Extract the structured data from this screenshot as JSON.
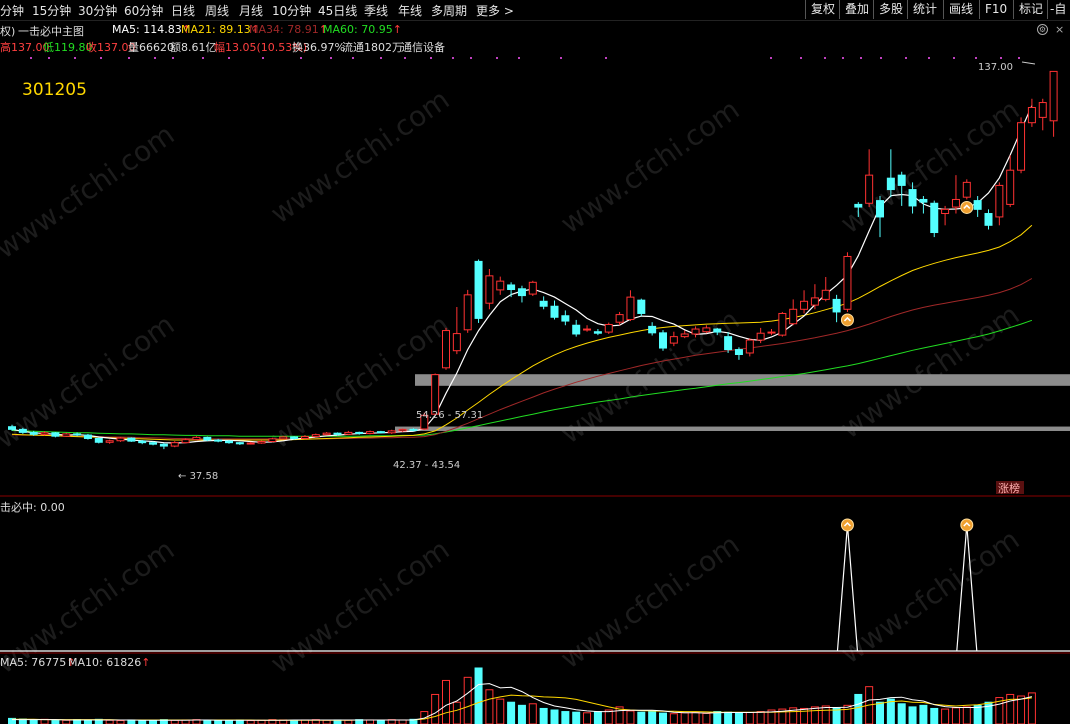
{
  "toolbar": {
    "periods": [
      "分钟",
      "15分钟",
      "30分钟",
      "60分钟",
      "日线",
      "周线",
      "月线",
      "10分钟",
      "45日线",
      "季线",
      "年线",
      "多周期",
      "更多 >"
    ],
    "buttons": [
      "复权",
      "叠加",
      "多股",
      "统计",
      "画线",
      "F10",
      "标记",
      "-自"
    ]
  },
  "header": {
    "left_tag": "权)",
    "indicator_name": "一击必中主图",
    "ma5": "MA5: 114.83",
    "ma21": "MA21: 89.13",
    "ma34": "MA34: 78.91",
    "ma60": "MA60: 70.95",
    "ma_colors": {
      "ma5": "#ffffff",
      "ma21": "#ffd800",
      "ma34": "#b03030",
      "ma60": "#22dd22"
    }
  },
  "quote": {
    "high": "高137.00",
    "low": "低119.80",
    "close": "收137.00",
    "volume": "量66620",
    "amount": "额8.61亿",
    "change": "幅13.05(10.53%)",
    "turnover": "换36.97%",
    "float": "流通1802万",
    "industry": "通信设备"
  },
  "stock_code": "301205",
  "annotations": {
    "max_price": "137.00",
    "min_price": "37.58",
    "band_upper": "54.26 - 57.31",
    "band_lower": "42.37 - 43.54",
    "limit_tag": "涨榜"
  },
  "signal_panel": {
    "title": "击必中: 0.00"
  },
  "volume_panel": {
    "ma5": "MA5: 76775",
    "ma10": "MA10: 61826"
  },
  "watermark": "www.cfchi.com",
  "colors": {
    "up": "#ff3232",
    "down": "#54ffff",
    "ma5": "#ffffff",
    "ma21": "#ffd800",
    "ma34": "#a02828",
    "ma60": "#22dd22",
    "band": "#8c8c8c",
    "signal": "#ffffff"
  },
  "chart_data": {
    "type": "candlestick",
    "ylim": [
      30,
      140
    ],
    "candles": [
      {
        "o": 43.5,
        "c": 42.8,
        "h": 44.0,
        "l": 42.4
      },
      {
        "o": 42.8,
        "c": 42.0,
        "h": 43.2,
        "l": 41.6
      },
      {
        "o": 42.0,
        "c": 41.5,
        "h": 42.4,
        "l": 41.1
      },
      {
        "o": 41.5,
        "c": 41.9,
        "h": 42.3,
        "l": 41.2
      },
      {
        "o": 41.9,
        "c": 41.0,
        "h": 42.1,
        "l": 40.7
      },
      {
        "o": 41.0,
        "c": 41.6,
        "h": 41.9,
        "l": 40.8
      },
      {
        "o": 41.6,
        "c": 41.3,
        "h": 42.0,
        "l": 41.0
      },
      {
        "o": 41.3,
        "c": 40.4,
        "h": 41.6,
        "l": 40.1
      },
      {
        "o": 40.4,
        "c": 39.4,
        "h": 40.6,
        "l": 39.1
      },
      {
        "o": 39.4,
        "c": 39.8,
        "h": 40.1,
        "l": 39.0
      },
      {
        "o": 39.8,
        "c": 40.5,
        "h": 40.8,
        "l": 39.5
      },
      {
        "o": 40.5,
        "c": 39.7,
        "h": 40.7,
        "l": 39.5
      },
      {
        "o": 39.7,
        "c": 39.3,
        "h": 40.0,
        "l": 38.9
      },
      {
        "o": 39.3,
        "c": 38.9,
        "h": 39.6,
        "l": 38.6
      },
      {
        "o": 38.9,
        "c": 38.4,
        "h": 39.2,
        "l": 37.6
      },
      {
        "o": 38.4,
        "c": 39.3,
        "h": 39.7,
        "l": 38.1
      },
      {
        "o": 39.3,
        "c": 40.1,
        "h": 40.4,
        "l": 39.1
      },
      {
        "o": 40.1,
        "c": 40.7,
        "h": 41.0,
        "l": 39.9
      },
      {
        "o": 40.7,
        "c": 40.0,
        "h": 40.9,
        "l": 39.7
      },
      {
        "o": 40.0,
        "c": 39.7,
        "h": 40.3,
        "l": 39.4
      },
      {
        "o": 39.7,
        "c": 39.3,
        "h": 40.0,
        "l": 39.0
      },
      {
        "o": 39.3,
        "c": 39.0,
        "h": 39.5,
        "l": 38.7
      },
      {
        "o": 39.0,
        "c": 39.2,
        "h": 39.5,
        "l": 38.8
      },
      {
        "o": 39.2,
        "c": 39.6,
        "h": 39.8,
        "l": 39.0
      },
      {
        "o": 39.6,
        "c": 40.3,
        "h": 40.6,
        "l": 39.4
      },
      {
        "o": 40.3,
        "c": 40.8,
        "h": 41.1,
        "l": 40.1
      },
      {
        "o": 40.8,
        "c": 40.4,
        "h": 41.0,
        "l": 40.1
      },
      {
        "o": 40.4,
        "c": 40.9,
        "h": 41.3,
        "l": 40.2
      },
      {
        "o": 40.9,
        "c": 41.4,
        "h": 41.7,
        "l": 40.7
      },
      {
        "o": 41.4,
        "c": 41.8,
        "h": 42.1,
        "l": 41.2
      },
      {
        "o": 41.8,
        "c": 41.5,
        "h": 42.0,
        "l": 41.2
      },
      {
        "o": 41.5,
        "c": 42.0,
        "h": 42.4,
        "l": 41.3
      },
      {
        "o": 42.0,
        "c": 41.7,
        "h": 42.2,
        "l": 41.4
      },
      {
        "o": 41.7,
        "c": 42.2,
        "h": 42.5,
        "l": 41.5
      },
      {
        "o": 42.2,
        "c": 41.9,
        "h": 42.4,
        "l": 41.7
      },
      {
        "o": 41.9,
        "c": 42.4,
        "h": 42.7,
        "l": 41.6
      },
      {
        "o": 42.4,
        "c": 42.8,
        "h": 43.0,
        "l": 42.1
      },
      {
        "o": 42.8,
        "c": 42.6,
        "h": 43.1,
        "l": 42.3
      },
      {
        "o": 42.9,
        "c": 46.5,
        "h": 47.2,
        "l": 42.6
      },
      {
        "o": 46.8,
        "c": 57.2,
        "h": 57.5,
        "l": 46.6
      },
      {
        "o": 59.0,
        "c": 68.8,
        "h": 69.5,
        "l": 58.5
      },
      {
        "o": 63.5,
        "c": 68.0,
        "h": 75.0,
        "l": 62.6
      },
      {
        "o": 69.0,
        "c": 78.2,
        "h": 79.5,
        "l": 68.2
      },
      {
        "o": 87.0,
        "c": 72.0,
        "h": 87.5,
        "l": 70.8
      },
      {
        "o": 76.0,
        "c": 83.2,
        "h": 85.0,
        "l": 74.4
      },
      {
        "o": 79.5,
        "c": 81.8,
        "h": 83.0,
        "l": 78.2
      },
      {
        "o": 80.8,
        "c": 79.6,
        "h": 81.5,
        "l": 77.6
      },
      {
        "o": 79.8,
        "c": 78.0,
        "h": 80.6,
        "l": 76.2
      },
      {
        "o": 78.4,
        "c": 81.5,
        "h": 81.9,
        "l": 77.9
      },
      {
        "o": 76.5,
        "c": 75.2,
        "h": 77.8,
        "l": 74.4
      },
      {
        "o": 75.2,
        "c": 72.3,
        "h": 76.7,
        "l": 71.7
      },
      {
        "o": 72.7,
        "c": 71.3,
        "h": 74.1,
        "l": 70.2
      },
      {
        "o": 70.2,
        "c": 67.9,
        "h": 71.6,
        "l": 67.2
      },
      {
        "o": 69.2,
        "c": 69.2,
        "h": 70.2,
        "l": 68.5
      },
      {
        "o": 68.5,
        "c": 68.1,
        "h": 69.2,
        "l": 67.6
      },
      {
        "o": 68.4,
        "c": 70.4,
        "h": 70.9,
        "l": 67.9
      },
      {
        "o": 71.0,
        "c": 73.0,
        "h": 73.7,
        "l": 70.2
      },
      {
        "o": 71.7,
        "c": 77.6,
        "h": 79.4,
        "l": 71.3
      },
      {
        "o": 76.8,
        "c": 73.3,
        "h": 77.2,
        "l": 72.6
      },
      {
        "o": 69.9,
        "c": 68.2,
        "h": 71.0,
        "l": 67.5
      },
      {
        "o": 68.2,
        "c": 64.2,
        "h": 68.9,
        "l": 63.5
      },
      {
        "o": 65.5,
        "c": 67.2,
        "h": 68.5,
        "l": 64.7
      },
      {
        "o": 67.2,
        "c": 67.9,
        "h": 68.8,
        "l": 66.8
      },
      {
        "o": 67.9,
        "c": 69.2,
        "h": 69.9,
        "l": 67.0
      },
      {
        "o": 68.5,
        "c": 69.5,
        "h": 70.2,
        "l": 68.1
      },
      {
        "o": 69.2,
        "c": 68.4,
        "h": 69.5,
        "l": 67.6
      },
      {
        "o": 67.2,
        "c": 63.8,
        "h": 68.4,
        "l": 62.9
      },
      {
        "o": 63.8,
        "c": 62.5,
        "h": 64.4,
        "l": 61.1
      },
      {
        "o": 62.9,
        "c": 66.3,
        "h": 66.8,
        "l": 62.0
      },
      {
        "o": 66.3,
        "c": 68.1,
        "h": 69.5,
        "l": 65.5
      },
      {
        "o": 68.4,
        "c": 68.4,
        "h": 69.2,
        "l": 67.6
      },
      {
        "o": 67.6,
        "c": 73.3,
        "h": 73.7,
        "l": 67.2
      },
      {
        "o": 70.6,
        "c": 74.4,
        "h": 77.0,
        "l": 70.2
      },
      {
        "o": 74.4,
        "c": 76.5,
        "h": 79.4,
        "l": 73.3
      },
      {
        "o": 75.5,
        "c": 77.4,
        "h": 81.0,
        "l": 74.4
      },
      {
        "o": 77.0,
        "c": 79.4,
        "h": 82.9,
        "l": 76.5
      },
      {
        "o": 77.0,
        "c": 73.7,
        "h": 78.2,
        "l": 71.0
      },
      {
        "o": 74.4,
        "c": 88.3,
        "h": 89.4,
        "l": 73.7
      },
      {
        "o": 102.0,
        "c": 101.3,
        "h": 102.6,
        "l": 98.7
      },
      {
        "o": 102.3,
        "c": 109.7,
        "h": 116.5,
        "l": 101.3
      },
      {
        "o": 103.0,
        "c": 98.7,
        "h": 104.2,
        "l": 93.4
      },
      {
        "o": 108.9,
        "c": 105.9,
        "h": 116.5,
        "l": 103.9
      },
      {
        "o": 109.7,
        "c": 107.0,
        "h": 110.6,
        "l": 101.6
      },
      {
        "o": 105.9,
        "c": 101.6,
        "h": 107.8,
        "l": 99.6
      },
      {
        "o": 103.3,
        "c": 102.6,
        "h": 104.2,
        "l": 99.6
      },
      {
        "o": 102.3,
        "c": 94.6,
        "h": 103.0,
        "l": 93.4
      },
      {
        "o": 99.6,
        "c": 100.7,
        "h": 101.6,
        "l": 96.5
      },
      {
        "o": 101.3,
        "c": 103.3,
        "h": 109.7,
        "l": 99.6
      },
      {
        "o": 103.9,
        "c": 107.8,
        "h": 108.6,
        "l": 103.3
      },
      {
        "o": 103.0,
        "c": 100.7,
        "h": 104.2,
        "l": 98.7
      },
      {
        "o": 99.6,
        "c": 96.5,
        "h": 100.7,
        "l": 95.4
      },
      {
        "o": 98.7,
        "c": 107.0,
        "h": 107.8,
        "l": 96.5
      },
      {
        "o": 102.0,
        "c": 111.0,
        "h": 114.9,
        "l": 101.3
      },
      {
        "o": 111.0,
        "c": 123.5,
        "h": 124.9,
        "l": 110.2
      },
      {
        "o": 123.5,
        "c": 127.5,
        "h": 129.8,
        "l": 122.4
      },
      {
        "o": 124.9,
        "c": 128.8,
        "h": 129.8,
        "l": 121.5
      },
      {
        "o": 124.0,
        "c": 137.0,
        "h": 137.0,
        "l": 119.8
      }
    ],
    "ma5": [
      42.8,
      42.3,
      41.9,
      41.7,
      41.5,
      41.3,
      41.4,
      41.2,
      40.8,
      40.5,
      40.2,
      40.0,
      39.8,
      39.6,
      39.3,
      39.2,
      39.3,
      39.6,
      39.8,
      39.9,
      39.9,
      39.8,
      39.6,
      39.4,
      39.5,
      39.8,
      40.2,
      40.5,
      40.8,
      41.1,
      41.3,
      41.5,
      41.7,
      41.8,
      41.9,
      42.0,
      42.2,
      42.3,
      43.0,
      46.4,
      52.3,
      57.6,
      63.8,
      68.8,
      72.8,
      76.4,
      78.3,
      79.2,
      79.7,
      78.8,
      77.6,
      75.9,
      74.2,
      72.0,
      70.6,
      70.0,
      70.2,
      71.8,
      72.6,
      72.5,
      71.4,
      70.5,
      69.0,
      67.8,
      68.0,
      68.6,
      68.2,
      67.3,
      66.5,
      66.2,
      67.1,
      68.4,
      70.5,
      72.6,
      75.6,
      78.4,
      80.7,
      83.4,
      88.5,
      95.0,
      101.4,
      104.3,
      104.6,
      104.3,
      102.1,
      101.0,
      100.7,
      100.8,
      101.1,
      102.4,
      105.0,
      109.0,
      115.0,
      121.5,
      128.0
    ],
    "ma21": [
      41.5,
      41.4,
      41.3,
      41.2,
      41.1,
      41.0,
      40.9,
      40.8,
      40.7,
      40.6,
      40.5,
      40.4,
      40.3,
      40.2,
      40.1,
      40.0,
      40.0,
      40.0,
      40.0,
      40.0,
      40.0,
      40.0,
      40.0,
      40.0,
      40.0,
      40.0,
      40.1,
      40.2,
      40.3,
      40.4,
      40.5,
      40.6,
      40.7,
      40.8,
      40.9,
      41.0,
      41.1,
      41.2,
      41.6,
      42.4,
      44.0,
      45.8,
      47.9,
      49.9,
      52.0,
      54.0,
      55.9,
      57.7,
      59.5,
      61.0,
      62.4,
      63.6,
      64.6,
      65.5,
      66.3,
      67.0,
      67.6,
      68.2,
      68.8,
      69.3,
      69.6,
      69.9,
      70.1,
      70.3,
      70.5,
      70.6,
      70.7,
      70.8,
      70.9,
      71.0,
      71.3,
      71.7,
      72.2,
      72.8,
      73.5,
      74.3,
      75.1,
      76.0,
      77.3,
      78.8,
      80.4,
      81.9,
      83.3,
      84.6,
      85.6,
      86.5,
      87.3,
      88.0,
      88.6,
      89.2,
      89.9,
      90.8,
      92.2,
      94.0,
      96.5
    ],
    "ma34": [
      41.4,
      41.3,
      41.3,
      41.2,
      41.1,
      41.1,
      41.0,
      40.9,
      40.9,
      40.8,
      40.8,
      40.7,
      40.6,
      40.6,
      40.5,
      40.4,
      40.4,
      40.3,
      40.3,
      40.3,
      40.3,
      40.3,
      40.3,
      40.3,
      40.3,
      40.3,
      40.3,
      40.3,
      40.3,
      40.3,
      40.4,
      40.4,
      40.5,
      40.5,
      40.6,
      40.6,
      40.7,
      40.7,
      40.9,
      41.4,
      42.3,
      43.3,
      44.4,
      45.6,
      46.8,
      48.0,
      49.1,
      50.2,
      51.3,
      52.4,
      53.4,
      54.3,
      55.2,
      56.0,
      56.8,
      57.5,
      58.2,
      58.9,
      59.6,
      60.2,
      60.8,
      61.3,
      61.8,
      62.3,
      62.7,
      63.1,
      63.5,
      63.9,
      64.2,
      64.6,
      65.0,
      65.4,
      65.9,
      66.4,
      66.9,
      67.5,
      68.1,
      68.8,
      69.6,
      70.5,
      71.5,
      72.5,
      73.4,
      74.2,
      74.9,
      75.5,
      76.0,
      76.5,
      77.0,
      77.5,
      78.1,
      78.8,
      79.7,
      80.9,
      82.5
    ],
    "ma60": [
      42.5,
      42.4,
      42.3,
      42.2,
      42.1,
      42.0,
      41.9,
      41.9,
      41.8,
      41.7,
      41.6,
      41.6,
      41.5,
      41.4,
      41.4,
      41.3,
      41.2,
      41.2,
      41.1,
      41.1,
      41.1,
      41.0,
      41.0,
      41.0,
      41.0,
      41.0,
      41.0,
      41.0,
      41.0,
      41.0,
      41.0,
      41.0,
      41.0,
      41.1,
      41.1,
      41.1,
      41.2,
      41.2,
      41.3,
      41.6,
      42.1,
      42.6,
      43.2,
      43.8,
      44.4,
      45.0,
      45.6,
      46.2,
      46.8,
      47.4,
      48.0,
      48.5,
      49.0,
      49.5,
      50.0,
      50.4,
      50.8,
      51.3,
      51.7,
      52.1,
      52.5,
      52.9,
      53.3,
      53.6,
      54.0,
      54.4,
      54.8,
      55.1,
      55.5,
      55.9,
      56.3,
      56.7,
      57.1,
      57.5,
      58.0,
      58.5,
      59.0,
      59.5,
      60.1,
      60.8,
      61.5,
      62.2,
      62.9,
      63.6,
      64.2,
      64.8,
      65.4,
      66.0,
      66.6,
      67.2,
      67.9,
      68.7,
      69.6,
      70.5,
      71.5
    ],
    "band_upper": [
      54.26,
      57.31
    ],
    "band_lower": [
      42.37,
      43.54
    ],
    "signal_markers_at": [
      77,
      88
    ],
    "signal_values": {
      "77": 1,
      "88": 1
    },
    "volume": [
      18,
      16,
      14,
      15,
      13,
      12,
      14,
      13,
      15,
      12,
      11,
      13,
      12,
      11,
      14,
      12,
      13,
      14,
      12,
      11,
      12,
      13,
      11,
      12,
      14,
      13,
      12,
      13,
      14,
      12,
      13,
      12,
      14,
      13,
      12,
      14,
      13,
      15,
      40,
      95,
      140,
      70,
      150,
      180,
      110,
      80,
      70,
      60,
      65,
      50,
      45,
      40,
      38,
      36,
      40,
      45,
      55,
      42,
      38,
      40,
      35,
      33,
      36,
      38,
      34,
      40,
      38,
      36,
      37,
      40,
      45,
      48,
      52,
      50,
      55,
      58,
      50,
      60,
      95,
      120,
      70,
      80,
      65,
      55,
      60,
      50,
      48,
      52,
      55,
      60,
      70,
      85,
      95,
      90,
      100
    ],
    "volume_ma5": [
      14,
      14,
      14,
      14,
      14,
      13,
      13,
      13,
      13,
      13,
      13,
      13,
      12,
      12,
      12,
      12,
      12,
      13,
      13,
      12,
      12,
      12,
      12,
      12,
      12,
      12,
      13,
      13,
      13,
      13,
      13,
      13,
      13,
      13,
      13,
      13,
      13,
      13,
      19,
      35,
      60,
      74,
      99,
      127,
      130,
      116,
      118,
      104,
      85,
      69,
      58,
      52,
      46,
      42,
      40,
      40,
      43,
      44,
      44,
      44,
      42,
      38,
      36,
      36,
      35,
      36,
      37,
      37,
      37,
      38,
      39,
      41,
      44,
      47,
      50,
      53,
      53,
      54,
      64,
      77,
      79,
      85,
      86,
      78,
      74,
      62,
      56,
      53,
      53,
      53,
      57,
      64,
      74,
      80,
      88
    ],
    "volume_ma10": [
      15,
      15,
      15,
      14,
      14,
      14,
      14,
      14,
      14,
      14,
      13,
      13,
      13,
      13,
      13,
      13,
      13,
      13,
      13,
      13,
      13,
      13,
      13,
      12,
      12,
      12,
      12,
      12,
      12,
      12,
      12,
      12,
      13,
      13,
      13,
      13,
      13,
      13,
      16,
      24,
      36,
      44,
      56,
      69,
      80,
      87,
      93,
      91,
      90,
      87,
      86,
      84,
      79,
      71,
      63,
      55,
      48,
      45,
      43,
      42,
      41,
      41,
      40,
      40,
      39,
      38,
      38,
      38,
      38,
      38,
      38,
      39,
      40,
      41,
      43,
      44,
      45,
      47,
      53,
      61,
      66,
      72,
      74,
      70,
      69,
      63,
      60,
      58,
      60,
      62,
      67,
      73,
      79,
      80,
      84
    ]
  }
}
